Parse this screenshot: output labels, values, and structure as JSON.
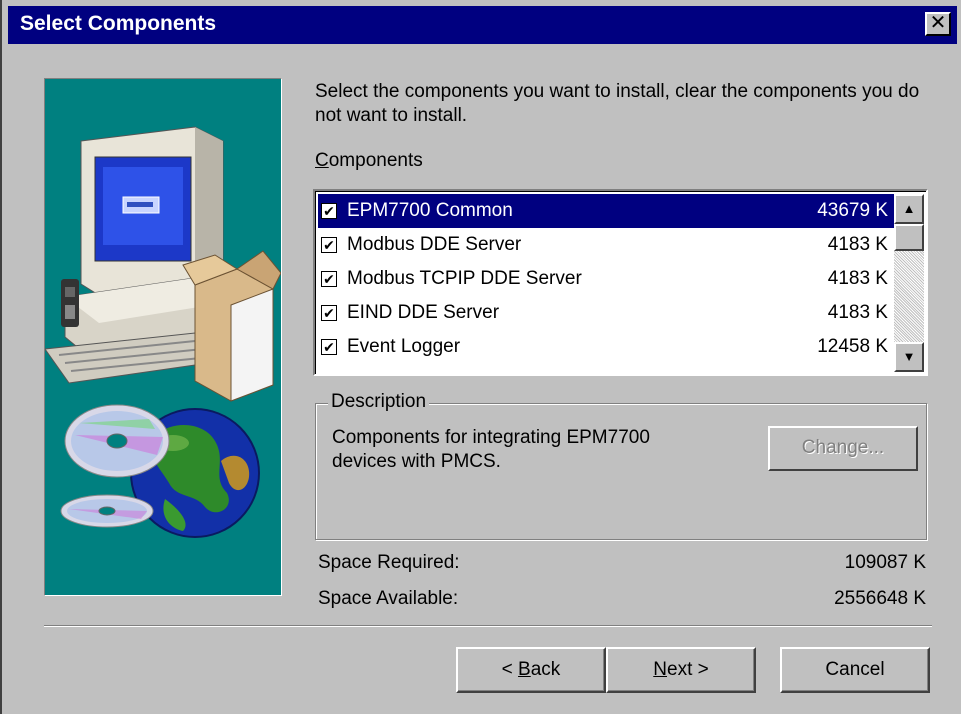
{
  "window": {
    "title": "Select Components",
    "close_glyph": "✕"
  },
  "intro_text": "Select the components you want to install, clear the components you do not want to install.",
  "components_label": {
    "mnemonic": "C",
    "rest": "omponents"
  },
  "components": [
    {
      "name": "EPM7700 Common",
      "size": "43679 K",
      "checked": true,
      "selected": true
    },
    {
      "name": "Modbus DDE Server",
      "size": "4183 K",
      "checked": true,
      "selected": false
    },
    {
      "name": "Modbus TCPIP DDE Server",
      "size": "4183 K",
      "checked": true,
      "selected": false
    },
    {
      "name": "EIND DDE Server",
      "size": "4183 K",
      "checked": true,
      "selected": false
    },
    {
      "name": "Event Logger",
      "size": "12458 K",
      "checked": true,
      "selected": false
    }
  ],
  "checkmark_glyph": "✔",
  "scrollbar": {
    "up_glyph": "▲",
    "down_glyph": "▼"
  },
  "description": {
    "title": "Description",
    "text": "Components for integrating EPM7700 devices with PMCS.",
    "change_button": "Change..."
  },
  "space": {
    "required_label": "Space Required:",
    "required_value": "109087 K",
    "available_label": "Space Available:",
    "available_value": "2556648 K"
  },
  "buttons": {
    "back_prefix": "< ",
    "back_mnemonic": "B",
    "back_rest": "ack",
    "next_mnemonic": "N",
    "next_rest": "ext >",
    "cancel": "Cancel"
  },
  "colors": {
    "titlebar": "#000080",
    "face": "#c0c0c0",
    "art_background": "#008080",
    "selection": "#000080"
  },
  "icons": [
    "computer-icon",
    "software-box-icon",
    "cd-disc-icon",
    "globe-icon"
  ]
}
